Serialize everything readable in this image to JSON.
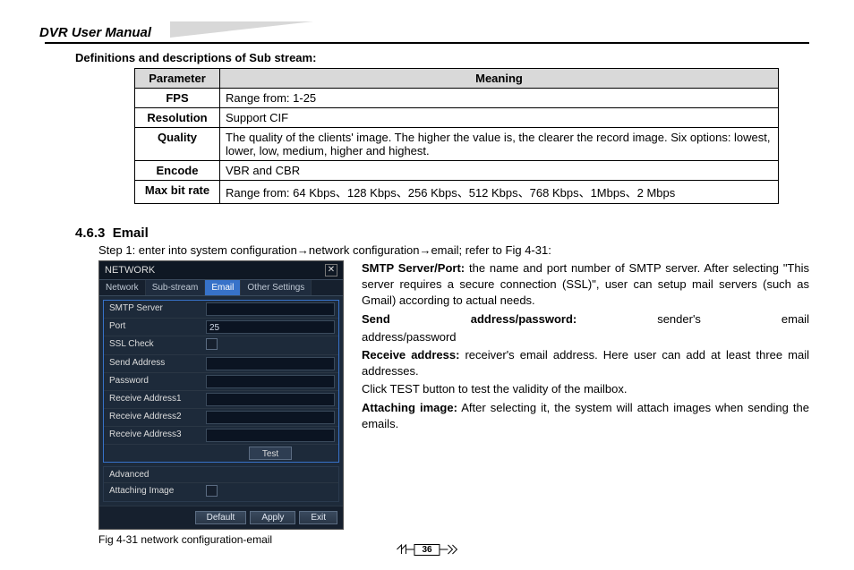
{
  "header": {
    "title": "DVR User Manual"
  },
  "defs_title": "Definitions and descriptions of Sub stream:",
  "table": {
    "headers": {
      "param": "Parameter",
      "meaning": "Meaning"
    },
    "rows": [
      {
        "param": "FPS",
        "meaning": "Range from: 1-25"
      },
      {
        "param": "Resolution",
        "meaning": "Support CIF"
      },
      {
        "param": "Quality",
        "meaning": "The quality of the clients' image. The higher the value is, the clearer the record image. Six options: lowest, lower, low, medium, higher and highest."
      },
      {
        "param": "Encode",
        "meaning": "VBR and CBR"
      },
      {
        "param": "Max bit rate",
        "meaning": "Range from: 64 Kbps、128 Kbps、256 Kbps、512 Kbps、768 Kbps、1Mbps、2 Mbps"
      }
    ]
  },
  "section": {
    "num": "4.6.3",
    "title": "Email"
  },
  "step1_prefix": "Step 1: enter into system configuration",
  "step1_mid": "network configuration",
  "step1_suffix": "email; refer to Fig 4-31:",
  "arrow": "→",
  "dialog": {
    "window_title": "NETWORK",
    "close": "✕",
    "tabs": {
      "network": "Network",
      "substream": "Sub-stream",
      "email": "Email",
      "other": "Other Settings"
    },
    "fields": {
      "smtp": "SMTP Server",
      "port": "Port",
      "port_val": "25",
      "ssl": "SSL Check",
      "send": "Send Address",
      "pass": "Password",
      "r1": "Receive Address1",
      "r2": "Receive Address2",
      "r3": "Receive Address3",
      "test": "Test",
      "advanced": "Advanced",
      "attach": "Attaching Image"
    },
    "buttons": {
      "default": "Default",
      "apply": "Apply",
      "exit": "Exit"
    }
  },
  "caption": "Fig 4-31 network configuration-email",
  "desc": {
    "smtp_b": "SMTP Server/Port:",
    "smtp_t": " the name and port number of SMTP server. After selecting \"This server requires a secure connection (SSL)\", user can setup mail servers (such as Gmail) according to actual needs.",
    "send_b": "Send",
    "send_b2": "address/password:",
    "send_t1": "sender's",
    "send_t2": "email",
    "send_line2": "address/password",
    "recv_b": "Receive address:",
    "recv_t": " receiver's email address. Here user can add at least three mail addresses.",
    "test": "Click TEST button to test the validity of the mailbox.",
    "attach_b": "Attaching image:",
    "attach_t": " After selecting it, the system will attach images when sending the emails."
  },
  "page_number": "36"
}
